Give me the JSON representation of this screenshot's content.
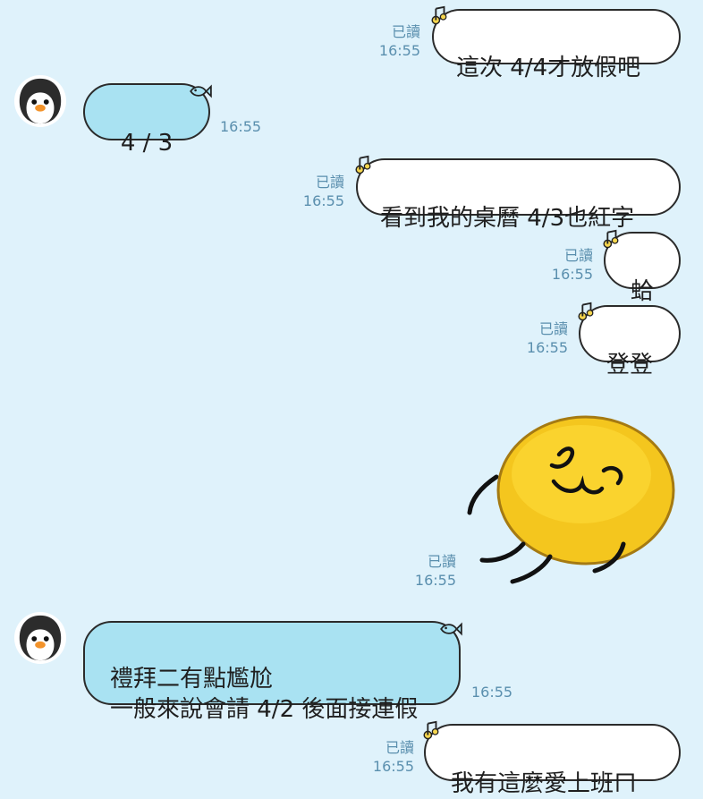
{
  "theme": {
    "background": "#dff2fb",
    "incoming_bubble": "#a9e2f2",
    "outgoing_bubble": "#ffffff",
    "border": "#2b2b2b",
    "meta_text": "#5a8fae"
  },
  "messages": [
    {
      "direction": "out",
      "text": "這次 4/4才放假吧",
      "read": "已讀",
      "time": "16:55"
    },
    {
      "direction": "in",
      "text": "4 / 3",
      "time": "16:55",
      "avatar": "penguin-avatar"
    },
    {
      "direction": "out",
      "text": "看到我的桌曆 4/3也紅字",
      "read": "已讀",
      "time": "16:55"
    },
    {
      "direction": "out",
      "text": "蛤",
      "read": "已讀",
      "time": "16:55"
    },
    {
      "direction": "out",
      "text": "登登",
      "read": "已讀",
      "time": "16:55"
    },
    {
      "direction": "out",
      "sticker": "yellow-blob-sticker",
      "read": "已讀",
      "time": "16:55"
    },
    {
      "direction": "in",
      "text": "禮拜二有點尷尬\n一般來說會請 4/2 後面接連假",
      "time": "16:55",
      "avatar": "penguin-avatar"
    },
    {
      "direction": "out",
      "text": "我有這麼愛上班ㄇ",
      "read": "已讀",
      "time": "16:55"
    }
  ]
}
